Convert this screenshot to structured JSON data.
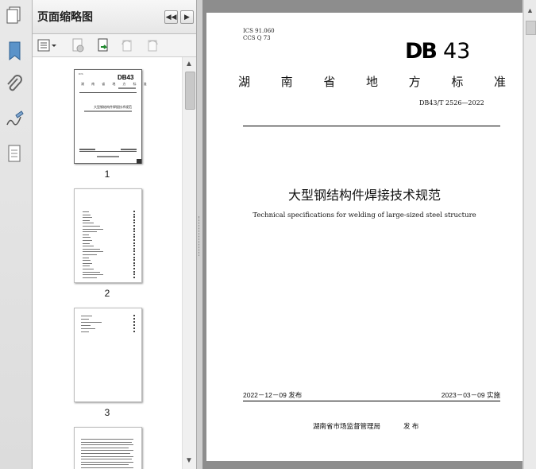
{
  "thumbnail_panel": {
    "title": "页面缩略图",
    "nav_first": "◀◀",
    "nav_next": "▶",
    "page_numbers": [
      "1",
      "2",
      "3"
    ]
  },
  "document": {
    "ics": "ICS 91.060",
    "ccs": "CCS Q 73",
    "logo_db": "DB",
    "logo_num": "43",
    "standard_type_chars": [
      "湖",
      "南",
      "省",
      "地",
      "方",
      "标",
      "准"
    ],
    "standard_number": "DB43/T 2526—2022",
    "title_cn": "大型钢结构件焊接技术规范",
    "title_en": "Technical specifications for welding of large-sized steel structure",
    "issue_date": "2022－12－09",
    "issue_label": "发布",
    "impl_date": "2023－03－09",
    "impl_label": "实施",
    "publisher": "湖南省市场监督管理局",
    "publisher_action": "发 布"
  },
  "thumb1": {
    "logo": "DB43",
    "type_text": "湖 南 省 地 方 标 准",
    "title": "大型钢结构件焊接技术规范"
  },
  "colors": {
    "accent_icon": "#3a7bbf",
    "page_bg": "#ffffff",
    "view_bg": "#8d8d8d"
  }
}
